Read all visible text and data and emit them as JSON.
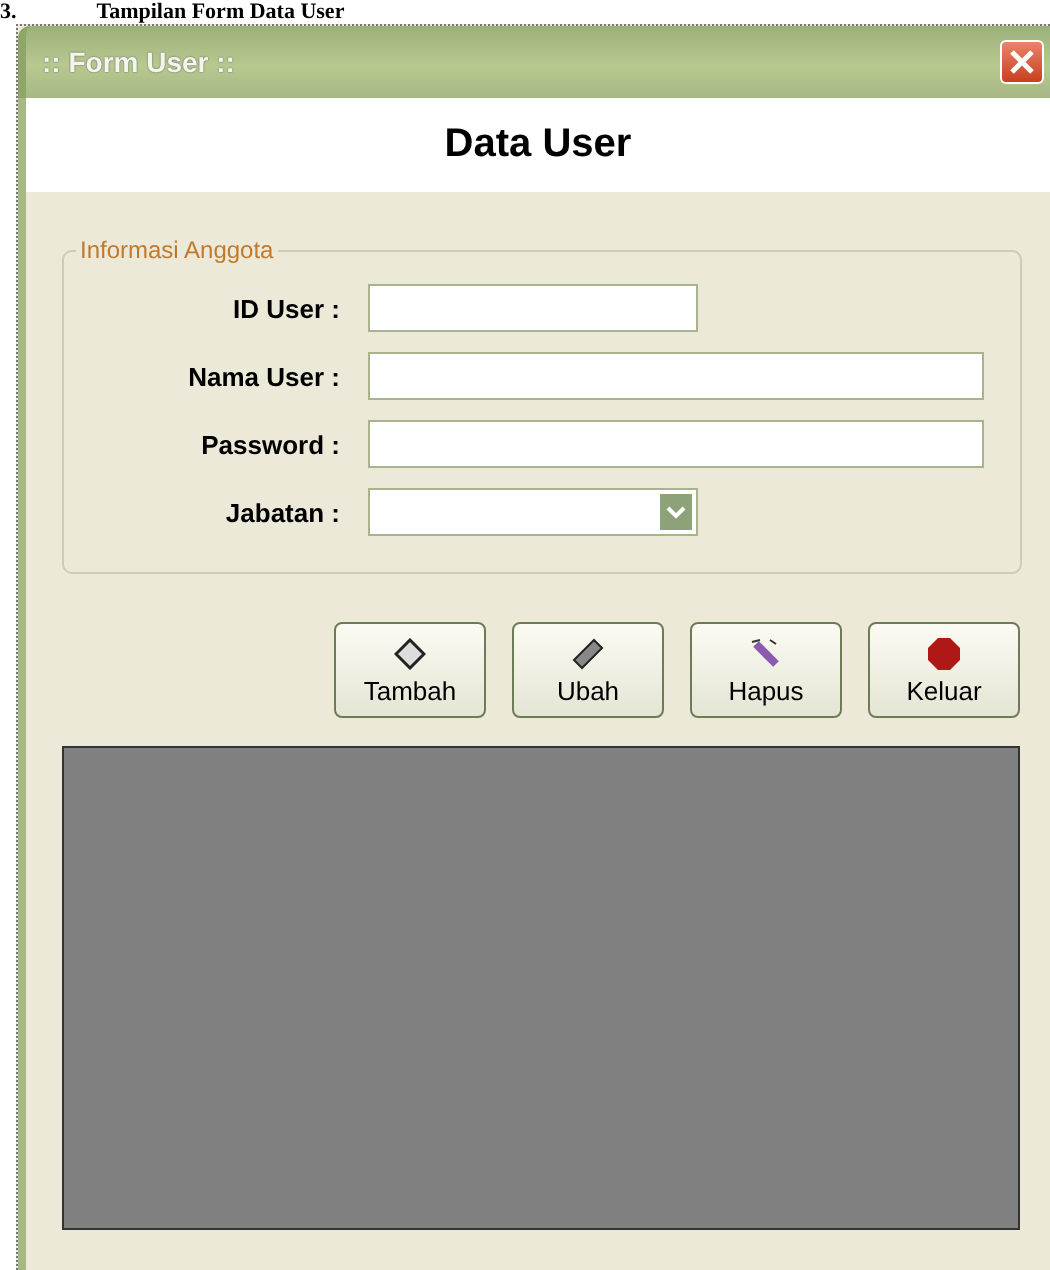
{
  "caption": {
    "number": "3.",
    "text": "Tampilan Form Data User"
  },
  "window": {
    "title": ":: Form User ::"
  },
  "header": "Data User",
  "group": {
    "title": "Informasi Anggota",
    "fields": [
      {
        "label": "ID User :",
        "kind": "short"
      },
      {
        "label": "Nama User :",
        "kind": "long"
      },
      {
        "label": "Password :",
        "kind": "long"
      },
      {
        "label": "Jabatan :",
        "kind": "combo"
      }
    ]
  },
  "buttons": [
    {
      "label": "Tambah",
      "kind": "add"
    },
    {
      "label": "Ubah",
      "kind": "edit"
    },
    {
      "label": "Hapus",
      "kind": "delete"
    },
    {
      "label": "Keluar",
      "kind": "exit"
    }
  ]
}
